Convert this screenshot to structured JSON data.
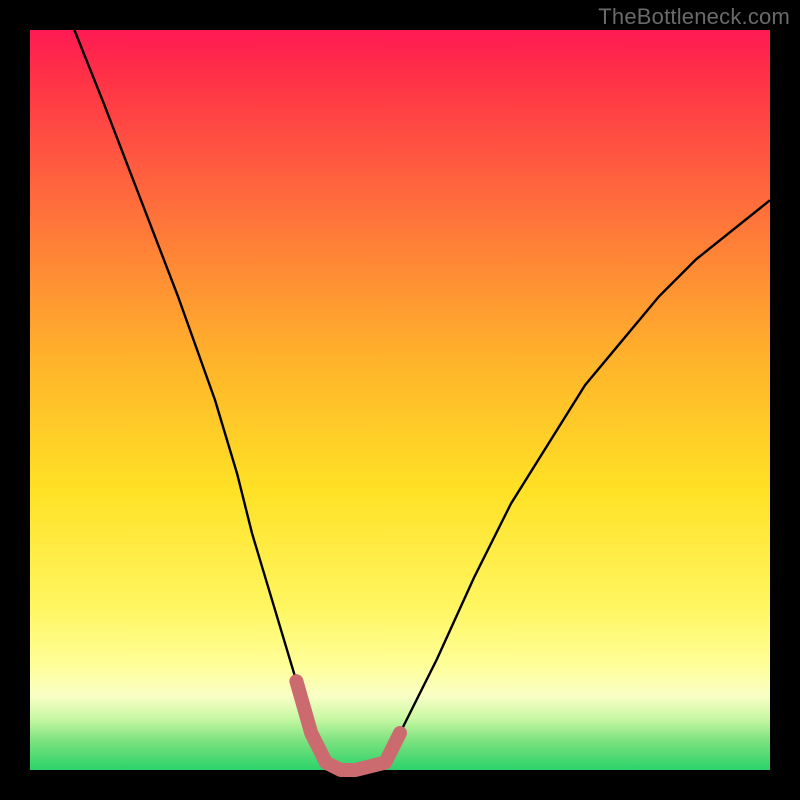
{
  "watermark": "TheBottleneck.com",
  "colors": {
    "background": "#000000",
    "gradient_top": "#ff1a53",
    "gradient_bottom": "#2bd36b",
    "curve_stroke": "#000000",
    "curve_marker": "#cb6a6f"
  },
  "chart_data": {
    "type": "line",
    "title": "",
    "xlabel": "",
    "ylabel": "",
    "xlim": [
      0,
      100
    ],
    "ylim": [
      0,
      100
    ],
    "annotations": [],
    "series": [
      {
        "name": "bottleneck-curve",
        "x": [
          6,
          10,
          15,
          20,
          25,
          28,
          30,
          33,
          36,
          38,
          40,
          42,
          44,
          48,
          50,
          55,
          60,
          65,
          70,
          75,
          80,
          85,
          90,
          95,
          100
        ],
        "y": [
          100,
          90,
          77,
          64,
          50,
          40,
          32,
          22,
          12,
          5,
          1,
          0,
          0,
          1,
          5,
          15,
          26,
          36,
          44,
          52,
          58,
          64,
          69,
          73,
          77
        ]
      }
    ],
    "minimum_region": {
      "x_start": 40,
      "x_end": 49,
      "y": 0
    }
  }
}
